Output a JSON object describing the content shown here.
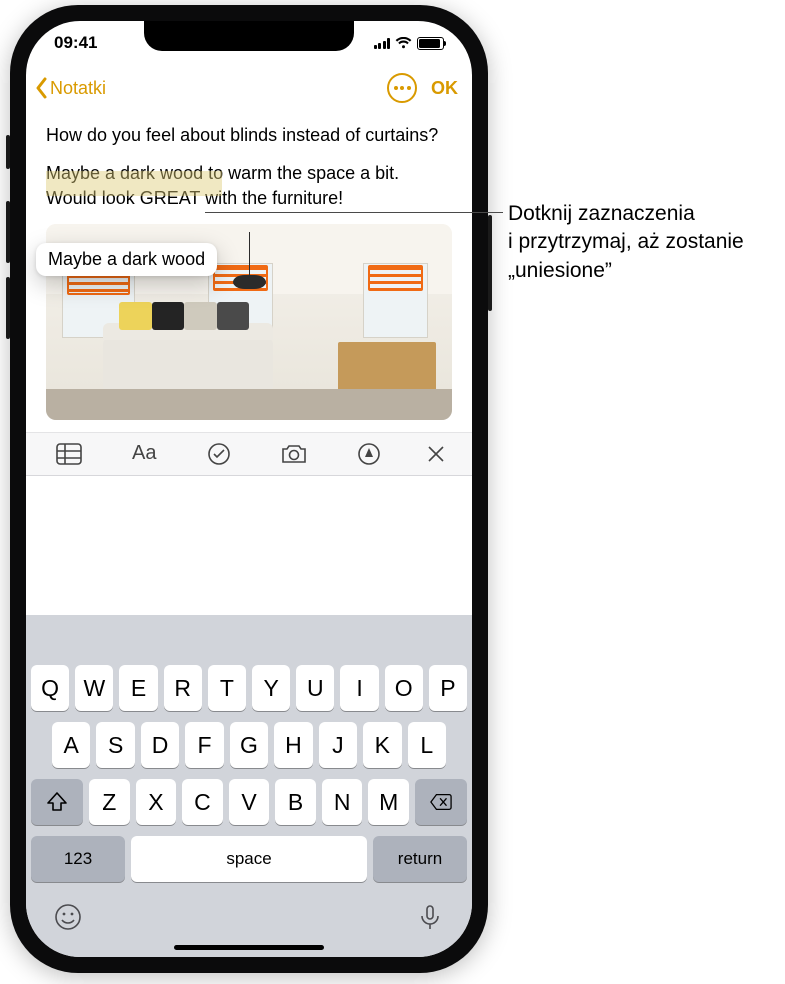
{
  "status": {
    "time": "09:41"
  },
  "nav": {
    "back_label": "Notatki",
    "done_label": "OK"
  },
  "note": {
    "para1": "How do you feel about blinds instead of curtains?",
    "para2_before": "Maybe a dark wood",
    "para2_mid": " to warm the space a bit. Would look GREAT with the furniture!",
    "lifted_selection": "Maybe a dark wood"
  },
  "predictions": {
    "left": "",
    "center": "",
    "right": ""
  },
  "keys": {
    "row1": [
      "Q",
      "W",
      "E",
      "R",
      "T",
      "Y",
      "U",
      "I",
      "O",
      "P"
    ],
    "row2": [
      "A",
      "S",
      "D",
      "F",
      "G",
      "H",
      "J",
      "K",
      "L"
    ],
    "row3": [
      "Z",
      "X",
      "C",
      "V",
      "B",
      "N",
      "M"
    ],
    "numeric_label": "123",
    "space_label": "space",
    "return_label": "return"
  },
  "callout": {
    "text": "Dotknij zaznaczenia i przytrzymaj, aż zostanie „uniesione”"
  }
}
